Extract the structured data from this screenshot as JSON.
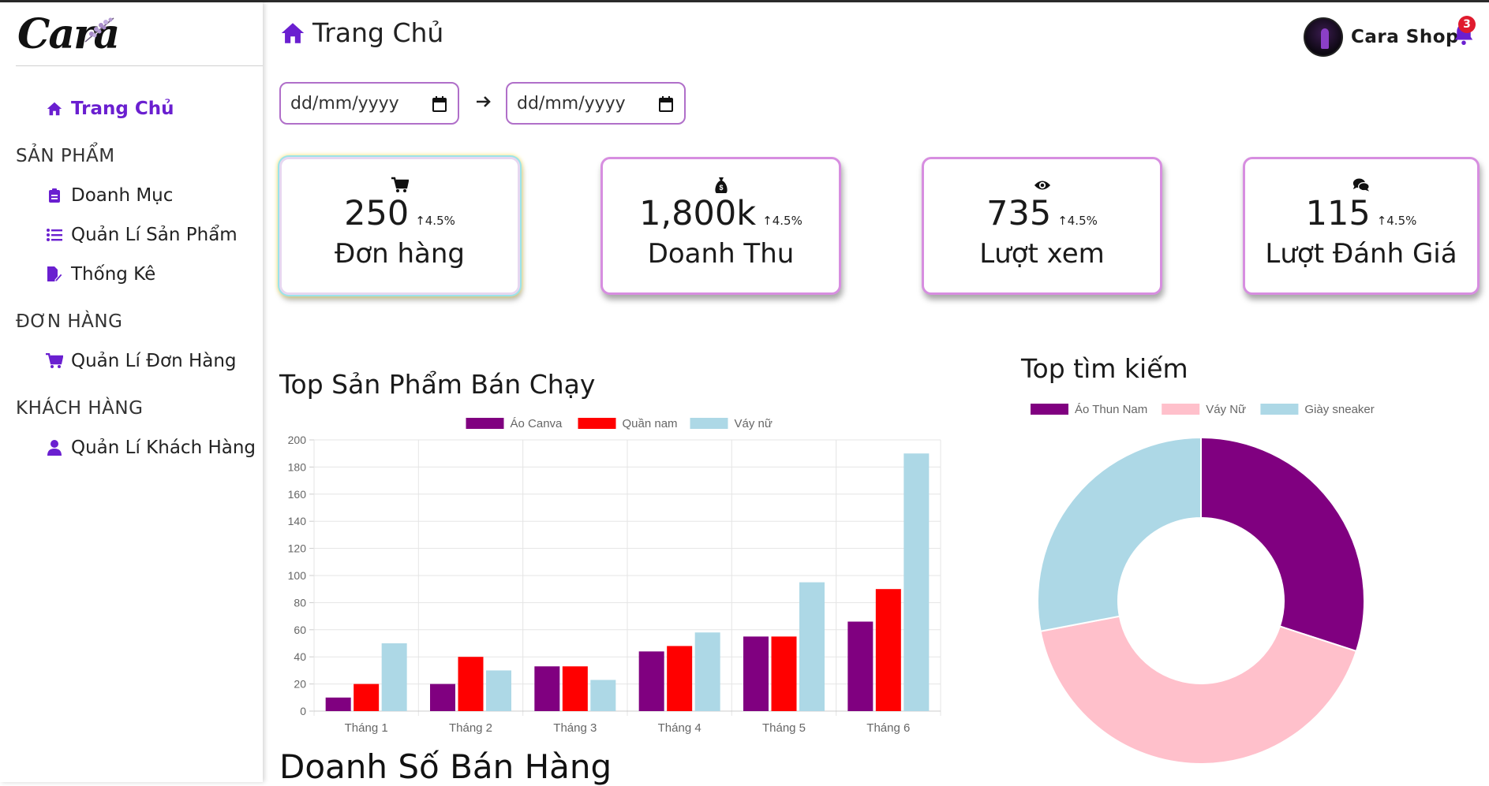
{
  "app": {
    "logo_text": "Cara"
  },
  "sidebar": {
    "home": "Trang Chủ",
    "sections": [
      {
        "title": "SẢN PHẨM",
        "items": [
          "Doanh Mục",
          "Quản Lí Sản Phẩm",
          "Thống Kê"
        ]
      },
      {
        "title": "ĐƠN HÀNG",
        "items": [
          "Quản Lí Đơn Hàng"
        ]
      },
      {
        "title": "KHÁCH HÀNG",
        "items": [
          "Quản Lí Khách Hàng"
        ]
      }
    ]
  },
  "header": {
    "title": "Trang Chủ",
    "user_name": "Cara Shop",
    "notification_count": "3"
  },
  "filters": {
    "date_from_placeholder": "dd/mm/yyyy",
    "date_to_placeholder": "dd/mm/yyyy"
  },
  "stats": [
    {
      "icon": "cart-icon",
      "value": "250",
      "change": "4.5%",
      "label": "Đơn hàng"
    },
    {
      "icon": "money-bag-icon",
      "value": "1,800k",
      "change": "4.5%",
      "label": "Doanh Thu"
    },
    {
      "icon": "eye-icon",
      "value": "735",
      "change": "4.5%",
      "label": "Lượt xem"
    },
    {
      "icon": "comments-icon",
      "value": "115",
      "change": "4.5%",
      "label": "Lượt Đánh Giá"
    }
  ],
  "colors": {
    "accent": "#6a1fd0",
    "card_border": "#d78ee0",
    "purple": "#800080",
    "red": "#ff0000",
    "lightblue": "#add8e6",
    "pink": "#ffc0cb"
  },
  "chart_data": [
    {
      "type": "bar",
      "title": "Top Sản Phẩm Bán Chạy",
      "categories": [
        "Tháng 1",
        "Tháng 2",
        "Tháng 3",
        "Tháng 4",
        "Tháng 5",
        "Tháng 6"
      ],
      "series": [
        {
          "name": "Áo Canva",
          "color": "#800080",
          "values": [
            10,
            20,
            33,
            44,
            55,
            66
          ]
        },
        {
          "name": "Quần nam",
          "color": "#ff0000",
          "values": [
            20,
            40,
            33,
            48,
            55,
            90
          ]
        },
        {
          "name": "Váy nữ",
          "color": "#add8e6",
          "values": [
            50,
            30,
            23,
            58,
            95,
            190
          ]
        }
      ],
      "ylim": [
        0,
        200
      ],
      "yticks": [
        0,
        20,
        40,
        60,
        80,
        100,
        120,
        140,
        160,
        180,
        200
      ],
      "grid": true,
      "legend": "top"
    },
    {
      "type": "pie",
      "title": "Top tìm kiếm",
      "labels": [
        "Áo Thun Nam",
        "Váy Nữ",
        "Giày sneaker"
      ],
      "values": [
        30,
        42,
        28
      ],
      "colors": [
        "#800080",
        "#ffc0cb",
        "#add8e6"
      ],
      "legend": "top"
    }
  ],
  "bottom_section_title": "Doanh Số Bán Hàng"
}
